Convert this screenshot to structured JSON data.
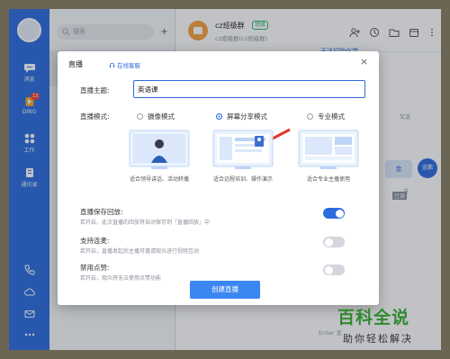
{
  "rail": {
    "items": [
      {
        "label": "消息",
        "icon": "chat-icon"
      },
      {
        "label": "DING",
        "icon": "ding-icon",
        "badge": "13"
      },
      {
        "label": "工作",
        "icon": "work-grid-icon"
      },
      {
        "label": "通讯录",
        "icon": "contacts-icon"
      }
    ],
    "bottom_icons": [
      "phone-icon",
      "cloud-icon",
      "mail-icon",
      "more-icon"
    ]
  },
  "sessions": {
    "search_placeholder": "搜索",
    "add_label": "+"
  },
  "chat": {
    "group_name": "cz班级群",
    "group_tag": "班级",
    "group_sub": "cz班级群(cz班级群)",
    "notice": "无法初始化学",
    "side_text_1": "又送",
    "side_text_2": "送",
    "bubble": "金",
    "me_avatar": "金鹏",
    "input_hint": "Enter 发",
    "badge_text": "已读"
  },
  "modal": {
    "title": "直播",
    "cs_link": "在线客服",
    "close": "×",
    "theme_label": "直播主题:",
    "theme_value": "英语课",
    "mode_label": "直播模式:",
    "modes": [
      {
        "label": "摄像模式",
        "desc": "适合领导讲话、活动转播",
        "checked": false
      },
      {
        "label": "屏幕分享模式",
        "desc": "适合远程培训、操作演示",
        "checked": true
      },
      {
        "label": "专业模式",
        "desc": "适合专业主播使用",
        "checked": false
      }
    ],
    "settings": [
      {
        "title": "直播保存回放:",
        "desc": "若开启，此次直播的回放将自动保存到「直播回放」中",
        "on": true
      },
      {
        "title": "支持连麦:",
        "desc": "若开启，直播发起后主播可邀请观众进行视频互动",
        "on": false
      },
      {
        "title": "禁用点赞:",
        "desc": "若开启，观众将无法使用点赞功能",
        "on": false
      }
    ],
    "create_button": "创建直播"
  },
  "colors": {
    "accent": "#2d6cdf",
    "button": "#3b86f0",
    "arrow": "#e23b2e",
    "watermark": "#2f8a2f"
  },
  "watermark": {
    "main": "百科全说",
    "sub": "助你轻松解决"
  }
}
